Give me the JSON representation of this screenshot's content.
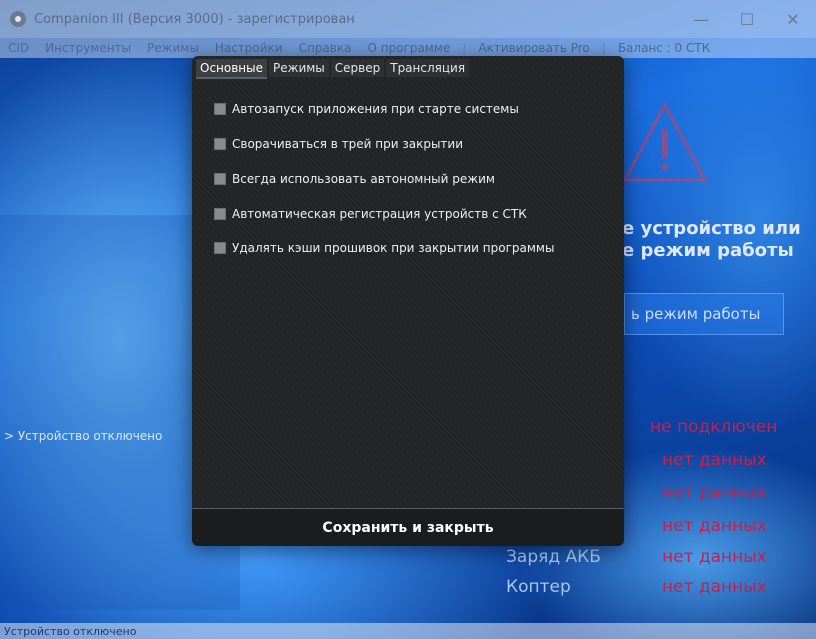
{
  "window": {
    "title": "Companion III (Версия 3000) - зарегистрирован",
    "minimize": "—",
    "maximize": "☐",
    "close": "✕"
  },
  "menu": [
    "CID",
    "Инструменты",
    "Режимы",
    "Настройки",
    "Справка",
    "О программе",
    "|",
    "Активировать Pro",
    "|",
    "Баланс : 0 СТК"
  ],
  "background": {
    "device_status": "> Устройство отключено",
    "heading_line1": "е устройство или",
    "heading_line2": "е режим работы",
    "mode_button": "ь режим работы",
    "info": [
      {
        "label": "",
        "value": "не подключен"
      },
      {
        "label": "",
        "value": "нет данных"
      },
      {
        "label": "",
        "value": "нет данных"
      },
      {
        "label": "",
        "value": "нет данных"
      },
      {
        "label": "Заряд АКБ",
        "value": "нет данных"
      },
      {
        "label": "Коптер",
        "value": "нет данных"
      }
    ]
  },
  "dialog": {
    "tabs": [
      "Основные",
      "Режимы",
      "Сервер",
      "Трансляция"
    ],
    "active_tab": "Основные",
    "options": [
      {
        "label": "Автозапуск приложения при старте системы",
        "checked": false
      },
      {
        "label": "Сворачиваться в трей при закрытии",
        "checked": false
      },
      {
        "label": "Всегда использовать автономный режим",
        "checked": false
      },
      {
        "label": "Автоматическая регистрация устройств с СТК",
        "checked": false
      },
      {
        "label": "Удалять кэши прошивок при закрытии программы",
        "checked": false
      }
    ],
    "save_label": "Сохранить и закрыть"
  },
  "statusbar": {
    "text": "Устройство отключено"
  },
  "colors": {
    "dialog_bg": "#222426",
    "value_red": "#c2224f",
    "checkbox": "#8a8a8a"
  }
}
